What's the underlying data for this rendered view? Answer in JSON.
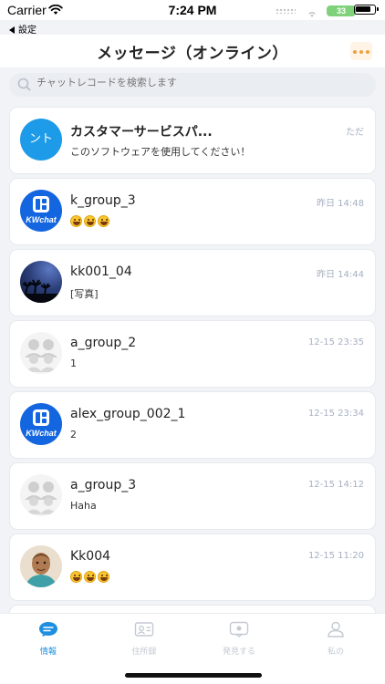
{
  "status_bar": {
    "carrier": "Carrier",
    "time": "7:24 PM",
    "ghost_battery": "33"
  },
  "back_link": {
    "label": "設定"
  },
  "header": {
    "title": "メッセージ（オンライン）"
  },
  "search": {
    "placeholder": "チャットレコードを検索します"
  },
  "conversations": [
    {
      "avatar_text": "ント",
      "avatar": "customer-service",
      "name": "カスタマーサービスパ...",
      "preview": "このソフトウェアを使用してください！",
      "time": "ただ"
    },
    {
      "avatar": "kwchat-logo",
      "avatar_text": "KWchat",
      "name": "k_group_3",
      "preview_emoji_count": 3,
      "time": "昨日 14:48"
    },
    {
      "avatar": "night-sky-photo",
      "name": "kk001_04",
      "preview": "[写真]",
      "time": "昨日 14:44"
    },
    {
      "avatar": "group-default",
      "name": "a_group_2",
      "preview": "1",
      "time": "12-15 23:35"
    },
    {
      "avatar": "kwchat-logo",
      "avatar_text": "KWchat",
      "name": "alex_group_002_1",
      "preview": "2",
      "time": "12-15 23:34"
    },
    {
      "avatar": "group-default",
      "name": "a_group_3",
      "preview": "Haha",
      "time": "12-15 14:12"
    },
    {
      "avatar": "person-cartoon",
      "name": "Kk004",
      "preview_emoji_count": 3,
      "time": "12-15 11:20"
    }
  ],
  "tabs": [
    {
      "label": "情報",
      "icon": "chat-bubble-icon",
      "active": true
    },
    {
      "label": "住所録",
      "icon": "contacts-icon",
      "active": false
    },
    {
      "label": "発見する",
      "icon": "discover-icon",
      "active": false
    },
    {
      "label": "私の",
      "icon": "profile-icon",
      "active": false
    }
  ],
  "colors": {
    "accent": "#1e8fe0",
    "avatar_blue": "#1466e0",
    "customer_service": "#1e9be8",
    "more_dots": "#f0a040",
    "time_text": "#a6b0c2"
  }
}
